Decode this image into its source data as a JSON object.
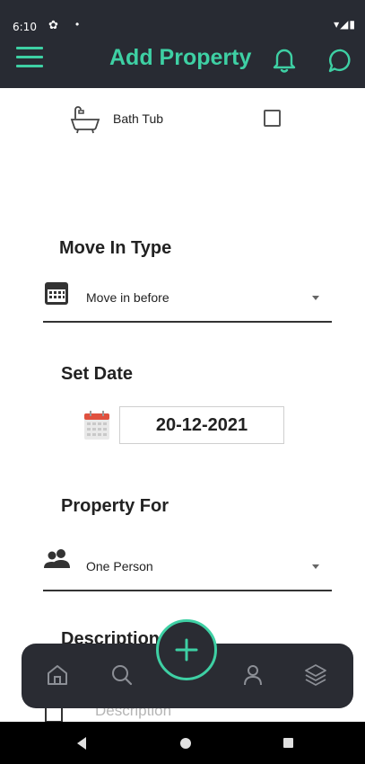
{
  "status_bar": {
    "time": "6:10",
    "gear": "✿",
    "dot": "•",
    "right": "▾◢▮"
  },
  "header": {
    "title": "Add Property"
  },
  "amenity": {
    "label": "Bath Tub",
    "checked": false
  },
  "move_in": {
    "heading": "Move In Type",
    "selected": "Move in before"
  },
  "set_date": {
    "heading": "Set Date",
    "value": "20-12-2021"
  },
  "property_for": {
    "heading": "Property For",
    "selected": "One Person"
  },
  "description": {
    "heading": "Description",
    "placeholder": "Description"
  },
  "colors": {
    "accent": "#3ed0a4",
    "bar": "#282b33"
  }
}
